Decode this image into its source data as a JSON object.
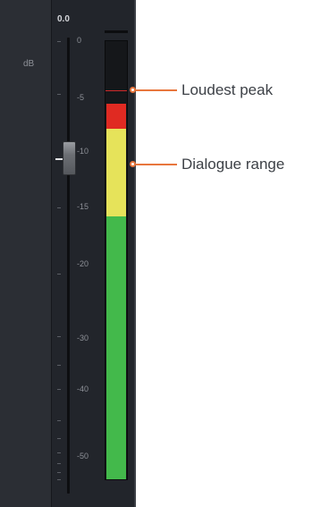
{
  "meter": {
    "level_readout": "0.0",
    "unit_label": "dB",
    "scale": [
      "0",
      "-5",
      "-10",
      "-15",
      "-20",
      "-30",
      "-40",
      "-50"
    ],
    "peak_db": -4,
    "segments": {
      "red_db": [
        -4.3,
        -8
      ],
      "yellow_db": [
        -8,
        -15.5
      ],
      "green_db": [
        -15.5,
        -60
      ]
    },
    "colors": {
      "red": "#e02a22",
      "yellow": "#e6e35a",
      "green": "#43b94b",
      "peak": "#cf2a2a"
    }
  },
  "callouts": {
    "loudest_peak": "Loudest peak",
    "dialogue_range": "Dialogue range",
    "color": "#e8763d"
  }
}
